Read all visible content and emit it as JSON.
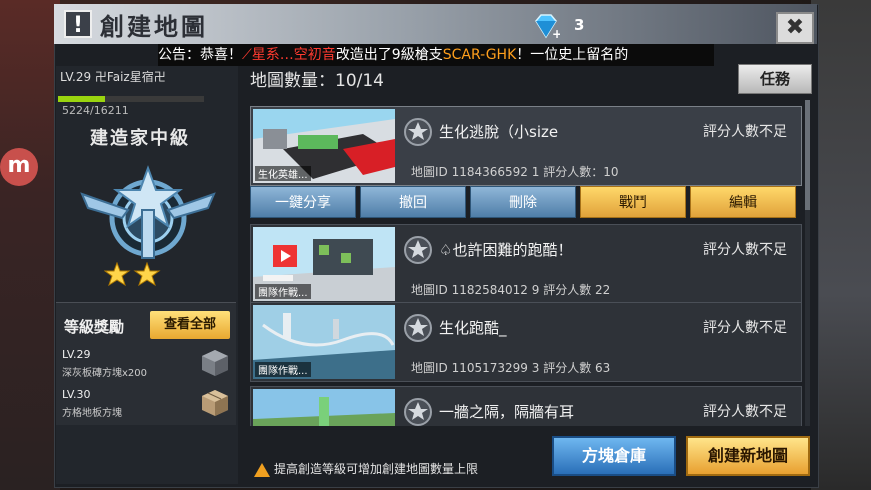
{
  "header": {
    "title": "創建地圖",
    "gem_count": "3",
    "close_label": "✖"
  },
  "marquee": {
    "prefix": "公告：恭喜！",
    "player": "⟋星系…空初音",
    "middle": "改造出了9級槍支",
    "weapon": "SCAR-GHK",
    "suffix": "！一位史上留名的"
  },
  "player": {
    "level_name": "LV.29 卍Faiz星宿卍",
    "xp": "5224/16211",
    "xp_fraction": 0.322,
    "rank_title": "建造家中級",
    "stars": 2
  },
  "rewards": {
    "title": "等級獎勵",
    "view_all": "查看全部",
    "items": [
      {
        "level": "LV.29",
        "item": "深灰板磚方塊x200"
      },
      {
        "level": "LV.30",
        "item": "方格地板方塊"
      }
    ]
  },
  "list": {
    "count_label": "地圖數量：10/14",
    "quest_label": "任務",
    "maps": [
      {
        "thumb_label": "生化英雄...",
        "name": "生化逃脫（小size",
        "rating": "評分人數不足",
        "id_text": "地圖ID 1184366592 1  評分人數：10"
      },
      {
        "thumb_label": "團隊作戰...",
        "name": "♤也許困難的跑酷！",
        "rating": "評分人數不足",
        "id_text": "地圖ID 1182584012 9  評分人數 22"
      },
      {
        "thumb_label": "團隊作戰...",
        "name": "生化跑酷_",
        "rating": "評分人數不足",
        "id_text": "地圖ID 1105173299 3  評分人數 63"
      },
      {
        "thumb_label": "",
        "name": "一牆之隔，隔牆有耳",
        "rating": "評分人數不足",
        "id_text": ""
      }
    ],
    "actions": {
      "share": "一鍵分享",
      "withdraw": "撤回",
      "delete": "刪除",
      "battle": "戰鬥",
      "edit": "編輯"
    }
  },
  "footer": {
    "tip": "提高創造等級可增加創建地圖數量上限",
    "store": "方塊倉庫",
    "create": "創建新地圖"
  }
}
